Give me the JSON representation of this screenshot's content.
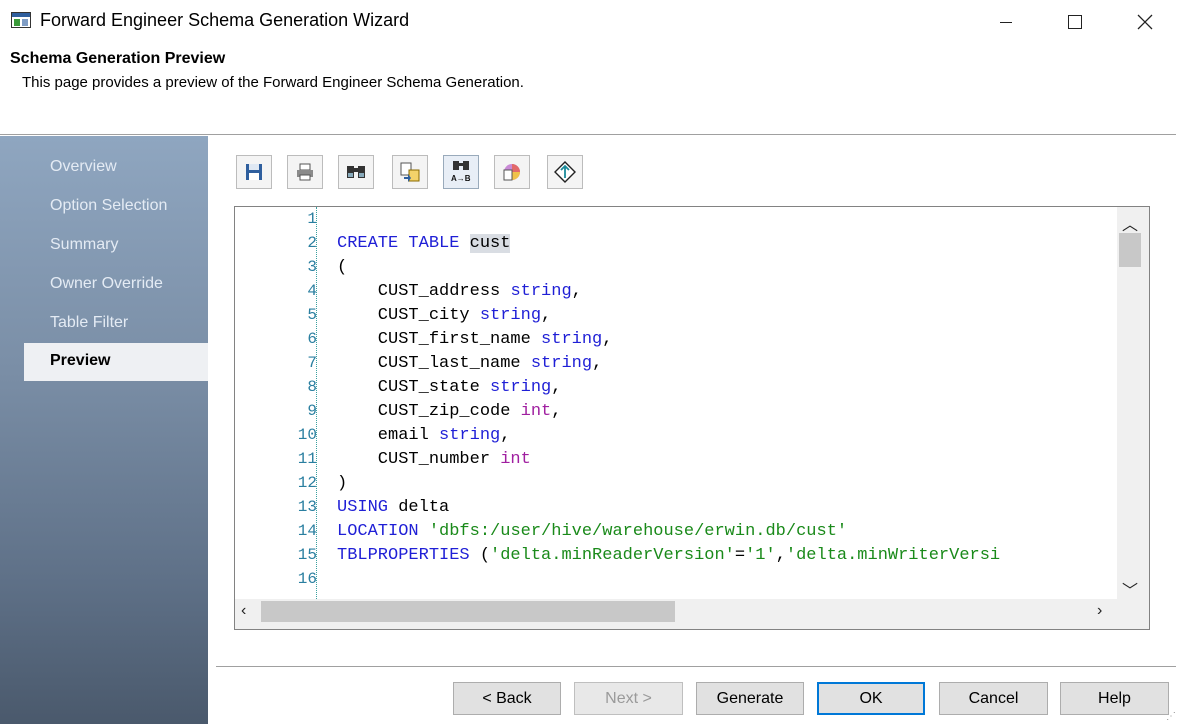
{
  "window": {
    "title": "Forward Engineer Schema Generation Wizard"
  },
  "header": {
    "title": "Schema Generation Preview",
    "description": "This page provides a preview of the Forward Engineer Schema Generation."
  },
  "sidebar": {
    "items": [
      {
        "label": "Overview"
      },
      {
        "label": "Option Selection"
      },
      {
        "label": "Summary"
      },
      {
        "label": "Owner Override"
      },
      {
        "label": "Table Filter"
      },
      {
        "label": "Preview",
        "active": true
      }
    ]
  },
  "toolbar": {
    "icons": [
      "save-icon",
      "print-icon",
      "find-icon",
      "copy-icon",
      "find-replace-icon",
      "palette-icon",
      "diamond-nav-icon"
    ]
  },
  "editor": {
    "line_numbers": [
      "1",
      "2",
      "3",
      "4",
      "5",
      "6",
      "7",
      "8",
      "9",
      "10",
      "11",
      "12",
      "13",
      "14",
      "15",
      "16"
    ],
    "lines": [
      [],
      [
        {
          "t": "CREATE TABLE ",
          "c": "kw"
        },
        {
          "t": "cust",
          "c": "hl"
        }
      ],
      [
        {
          "t": "(",
          "c": ""
        }
      ],
      [
        {
          "t": "    CUST_address ",
          "c": ""
        },
        {
          "t": "string",
          "c": "kw"
        },
        {
          "t": ",",
          "c": ""
        }
      ],
      [
        {
          "t": "    CUST_city ",
          "c": ""
        },
        {
          "t": "string",
          "c": "kw"
        },
        {
          "t": ",",
          "c": ""
        }
      ],
      [
        {
          "t": "    CUST_first_name ",
          "c": ""
        },
        {
          "t": "string",
          "c": "kw"
        },
        {
          "t": ",",
          "c": ""
        }
      ],
      [
        {
          "t": "    CUST_last_name ",
          "c": ""
        },
        {
          "t": "string",
          "c": "kw"
        },
        {
          "t": ",",
          "c": ""
        }
      ],
      [
        {
          "t": "    CUST_state ",
          "c": ""
        },
        {
          "t": "string",
          "c": "kw"
        },
        {
          "t": ",",
          "c": ""
        }
      ],
      [
        {
          "t": "    CUST_zip_code ",
          "c": ""
        },
        {
          "t": "int",
          "c": "ty"
        },
        {
          "t": ",",
          "c": ""
        }
      ],
      [
        {
          "t": "    email ",
          "c": ""
        },
        {
          "t": "string",
          "c": "kw"
        },
        {
          "t": ",",
          "c": ""
        }
      ],
      [
        {
          "t": "    CUST_number ",
          "c": ""
        },
        {
          "t": "int",
          "c": "ty"
        }
      ],
      [
        {
          "t": ")",
          "c": ""
        }
      ],
      [
        {
          "t": "USING",
          "c": "kw"
        },
        {
          "t": " delta",
          "c": ""
        }
      ],
      [
        {
          "t": "LOCATION ",
          "c": "kw"
        },
        {
          "t": "'dbfs:/user/hive/warehouse/erwin.db/cust'",
          "c": "str"
        }
      ],
      [
        {
          "t": "TBLPROPERTIES ",
          "c": "kw"
        },
        {
          "t": "(",
          "c": ""
        },
        {
          "t": "'delta.minReaderVersion'",
          "c": "str"
        },
        {
          "t": "=",
          "c": ""
        },
        {
          "t": "'1'",
          "c": "str"
        },
        {
          "t": ",",
          "c": ""
        },
        {
          "t": "'delta.minWriterVersi",
          "c": "str"
        }
      ],
      []
    ]
  },
  "buttons": {
    "back": "< Back",
    "next": "Next >",
    "generate": "Generate",
    "ok": "OK",
    "cancel": "Cancel",
    "help": "Help"
  },
  "colors": {
    "keyword": "#1f1fd6",
    "type": "#a01fa0",
    "string": "#1a8a1a",
    "line_number": "#2a7fa0",
    "default_button_border": "#0078d7"
  }
}
